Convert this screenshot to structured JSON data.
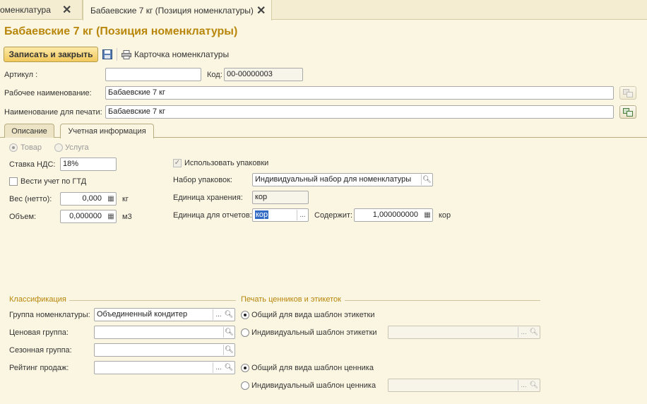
{
  "window_tabs": [
    {
      "label": "оменклатура",
      "close": "✕"
    },
    {
      "label": "Бабаевские 7 кг (Позиция номенклатуры)",
      "close": "✕"
    }
  ],
  "title": "Бабаевские 7 кг (Позиция номенклатуры)",
  "toolbar": {
    "save_close": "Записать и закрыть",
    "card": "Карточка номенклатуры"
  },
  "header": {
    "article_label": "Артикул :",
    "article_value": "",
    "code_label": "Код:",
    "code_value": "00-00000003",
    "work_name_label": "Рабочее наименование:",
    "work_name_value": "Бабаевские 7 кг",
    "print_name_label": "Наименование для печати:",
    "print_name_value": "Бабаевские 7 кг"
  },
  "form_tabs": [
    "Описание",
    "Учетная информация"
  ],
  "accounting": {
    "type_goods": "Товар",
    "type_service": "Услуга",
    "vat_label": "Ставка НДС:",
    "vat_value": "18%",
    "gtd_label": "Вести учет по ГТД",
    "weight_label": "Вес (нетто):",
    "weight_value": "0,000",
    "weight_unit": "кг",
    "volume_label": "Объем:",
    "volume_value": "0,000000",
    "volume_unit": "м3",
    "use_packages_label": "Использовать упаковки",
    "package_set_label": "Набор упаковок:",
    "package_set_value": "Индивидуальный набор для номенклатуры",
    "storage_unit_label": "Единица хранения:",
    "storage_unit_value": "кор",
    "report_unit_label": "Единица для отчетов:",
    "report_unit_value": "кор",
    "contains_label": "Содержит:",
    "contains_value": "1,000000000",
    "contains_unit": "кор"
  },
  "classification": {
    "section": "Классификация",
    "group_label": "Группа номенклатуры:",
    "group_value": "Объединенный кондитер",
    "price_group_label": "Ценовая группа:",
    "season_group_label": "Сезонная группа:",
    "rating_label": "Рейтинг продаж:"
  },
  "printing": {
    "section": "Печать ценников и этикеток",
    "label_common": "Общий для вида шаблон этикетки",
    "label_individual": "Индивидуальный шаблон этикетки",
    "tag_common": "Общий для вида шаблон ценника",
    "tag_individual": "Индивидуальный шаблон ценника"
  },
  "colors": {
    "accent": "#b8860b",
    "background": "#fbf6e2",
    "selection": "#316ac5"
  }
}
